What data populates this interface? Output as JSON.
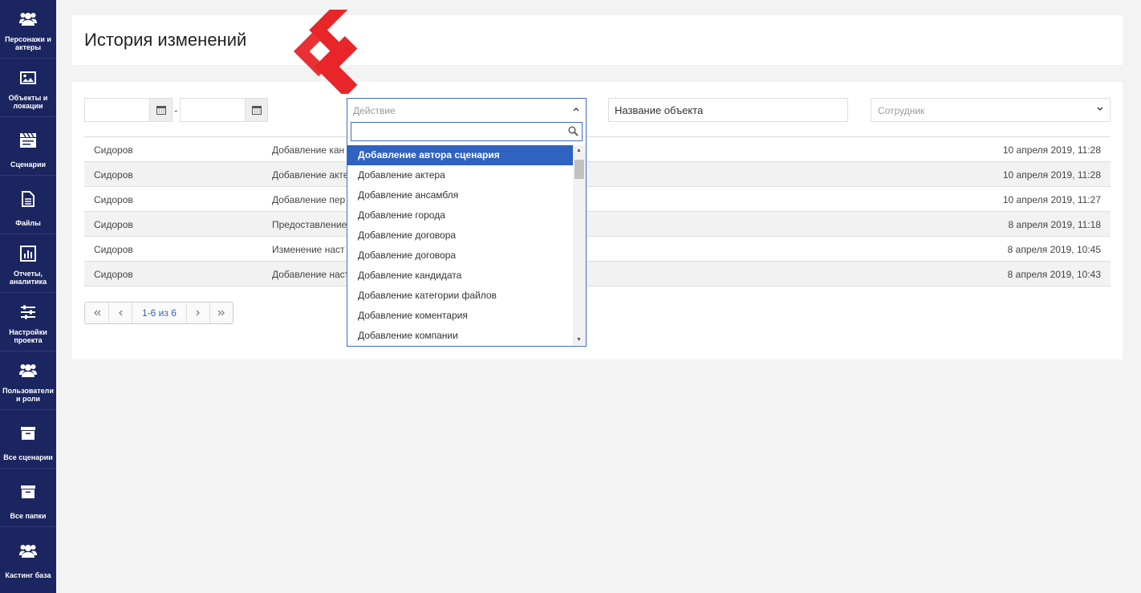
{
  "sidebar": {
    "items": [
      {
        "label": "Персонажи и актеры",
        "icon": "users-icon"
      },
      {
        "label": "Объекты и локации",
        "icon": "image-icon"
      },
      {
        "label": "Сценарии",
        "icon": "clapperboard-icon"
      },
      {
        "label": "Файлы",
        "icon": "file-icon"
      },
      {
        "label": "Отчеты, аналитика",
        "icon": "chart-icon"
      },
      {
        "label": "Настройки проекта",
        "icon": "sliders-icon"
      },
      {
        "label": "Пользователи и роли",
        "icon": "users-icon"
      },
      {
        "label": "Все сценарии",
        "icon": "archive-icon"
      },
      {
        "label": "Все папки",
        "icon": "archive-icon"
      },
      {
        "label": "Кастинг база",
        "icon": "users-icon"
      }
    ]
  },
  "header": {
    "title": "История изменений"
  },
  "filters": {
    "date_separator": "-",
    "action_placeholder": "Действие",
    "object_placeholder": "Название объекта",
    "employee_placeholder": "Сотрудник"
  },
  "table": {
    "rows": [
      {
        "user": "Сидоров",
        "action": "Добавление кан",
        "date": "10 апреля 2019, 11:28"
      },
      {
        "user": "Сидоров",
        "action": "Добавление акте",
        "date": "10 апреля 2019, 11:28"
      },
      {
        "user": "Сидоров",
        "action": "Добавление пер",
        "date": "10 апреля 2019, 11:27"
      },
      {
        "user": "Сидоров",
        "action": "Предоставление",
        "date": "8 апреля 2019, 11:18"
      },
      {
        "user": "Сидоров",
        "action": "Изменение наст",
        "date": "8 апреля 2019, 10:45"
      },
      {
        "user": "Сидоров",
        "action": "Добавление наст",
        "date": "8 апреля 2019, 10:43"
      }
    ]
  },
  "pager": {
    "info": "1-6 из 6"
  },
  "dropdown": {
    "options": [
      "Добавление автора сценария",
      "Добавление актера",
      "Добавление ансамбля",
      "Добавление города",
      "Добавление договора",
      "Добавление договора",
      "Добавление кандидата",
      "Добавление категории файлов",
      "Добавление коментария",
      "Добавление компании"
    ],
    "selected_index": 0
  },
  "colors": {
    "sidebar": "#1b2660",
    "accent": "#2f62c1",
    "annotation": "#e8262a"
  }
}
